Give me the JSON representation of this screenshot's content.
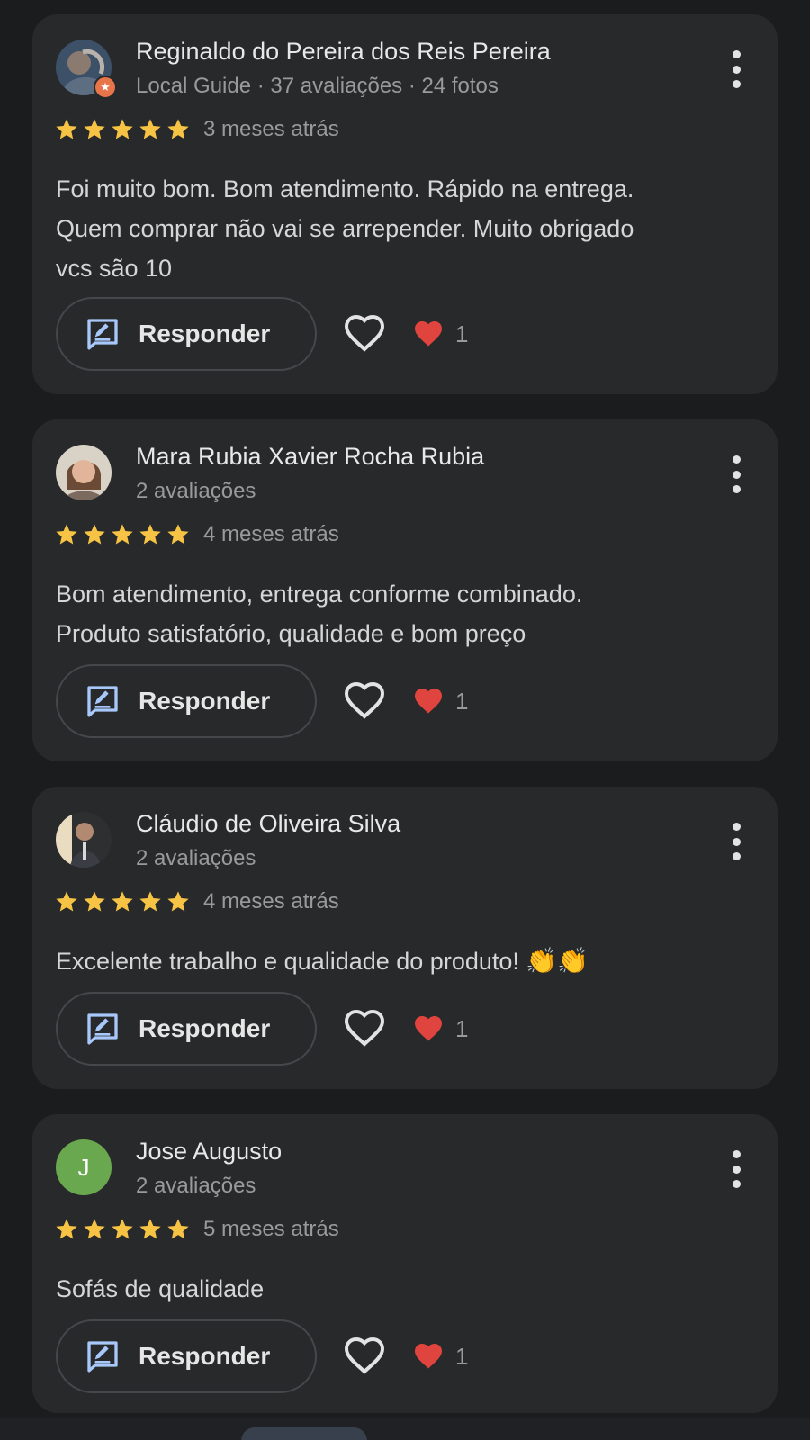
{
  "colors": {
    "background": "#1b1c1e",
    "card": "#28292b",
    "star": "#f6c344",
    "reply_icon": "#a8c7fa",
    "heart_reaction": "#e0443e",
    "avatar_letter_bg": "#6aa84f",
    "local_guide_badge": "#e8744a"
  },
  "icons": {
    "star": "star-icon",
    "reply": "reply-icon",
    "like": "heart-outline-icon",
    "reaction": "red-heart-icon",
    "menu": "more-vert-icon"
  },
  "reviews": [
    {
      "name": "Reginaldo do Pereira dos Reis Pereira",
      "meta": "Local Guide · 37 avaliações · 24 fotos",
      "rating": 5,
      "time": "3 meses atrás",
      "text": "Foi muito bom. Bom atendimento. Rápido na entrega.\nQuem comprar não vai se arrepender. Muito obrigado\nvcs são 10",
      "reply_label": "Responder",
      "reaction_count": "1",
      "local_guide": true
    },
    {
      "name": "Mara Rubia Xavier Rocha Rubia",
      "meta": "2 avaliações",
      "rating": 5,
      "time": "4 meses atrás",
      "text": "Bom atendimento, entrega conforme combinado.\nProduto satisfatório, qualidade e bom preço",
      "reply_label": "Responder",
      "reaction_count": "1"
    },
    {
      "name": "Cláudio de Oliveira Silva",
      "meta": "2 avaliações",
      "rating": 5,
      "time": "4 meses atrás",
      "text": "Excelente trabalho e qualidade do produto!",
      "emoji": "👏👏",
      "reply_label": "Responder",
      "reaction_count": "1"
    },
    {
      "name": "Jose Augusto",
      "avatar_letter": "J",
      "meta": "2 avaliações",
      "rating": 5,
      "time": "5 meses atrás",
      "text": "Sofás de qualidade",
      "reply_label": "Responder",
      "reaction_count": "1"
    }
  ]
}
